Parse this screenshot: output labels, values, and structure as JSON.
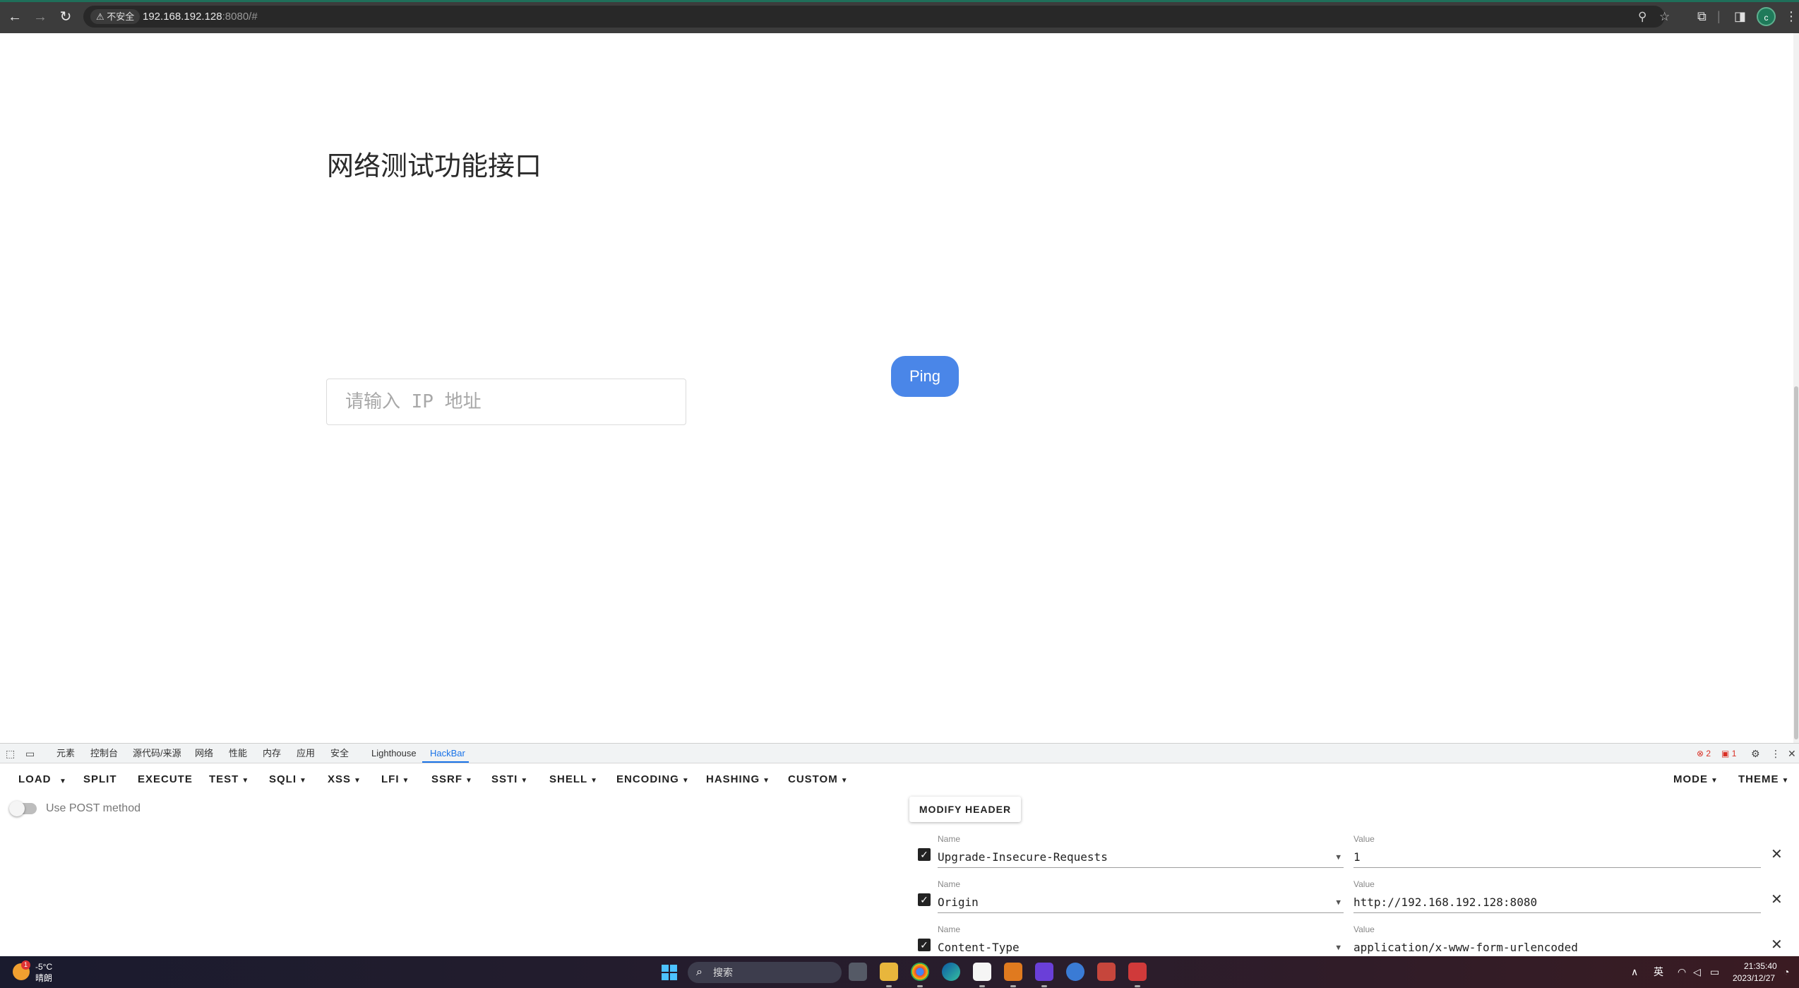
{
  "browser": {
    "security_chip": "⚠ 不安全",
    "url_host": "192.168.192.128",
    "url_rest": ":8080/#",
    "profile_initial": "c"
  },
  "page": {
    "title": "网络测试功能接口",
    "ip_placeholder": "请输入 IP 地址",
    "ping_label": "Ping"
  },
  "devtools": {
    "tabs": [
      "元素",
      "控制台",
      "源代码/来源",
      "网络",
      "性能",
      "内存",
      "应用",
      "安全",
      "Lighthouse",
      "HackBar"
    ],
    "active_tab": "HackBar",
    "error_count": "2",
    "issue_count": "1"
  },
  "hackbar": {
    "toolbar": {
      "load": "LOAD",
      "split": "SPLIT",
      "execute": "EXECUTE",
      "test": "TEST",
      "sqli": "SQLI",
      "xss": "XSS",
      "lfi": "LFI",
      "ssrf": "SSRF",
      "ssti": "SSTI",
      "shell": "SHELL",
      "encoding": "ENCODING",
      "hashing": "HASHING",
      "custom": "CUSTOM",
      "mode": "MODE",
      "theme": "THEME"
    },
    "post_label": "Use POST method",
    "modify_header": "MODIFY HEADER",
    "name_label": "Name",
    "value_label": "Value",
    "headers": [
      {
        "name": "Upgrade-Insecure-Requests",
        "value": "1"
      },
      {
        "name": "Origin",
        "value": "http://192.168.192.128:8080"
      },
      {
        "name": "Content-Type",
        "value": "application/x-www-form-urlencoded"
      }
    ]
  },
  "taskbar": {
    "temperature": "-5°C",
    "condition": "晴朗",
    "weather_badge": "1",
    "search_placeholder": "搜索",
    "ime": "英",
    "time": "21:35:40",
    "date": "2023/12/27"
  },
  "colors": {
    "ping_button": "#4a86e8",
    "devtools_active": "#1a73e8",
    "error": "#d93025"
  }
}
